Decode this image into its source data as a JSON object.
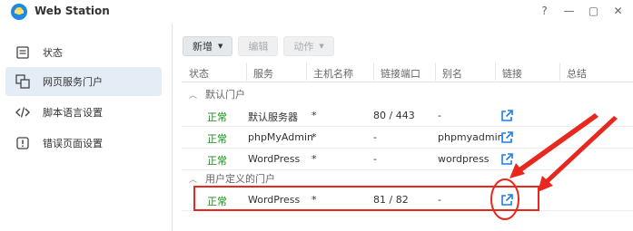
{
  "window": {
    "title": "Web Station",
    "controls": [
      "?",
      "—",
      "▢",
      "✕"
    ]
  },
  "sidebar": {
    "items": [
      {
        "label": "状态",
        "icon": "list-icon"
      },
      {
        "label": "网页服务门户",
        "icon": "portal-icon",
        "active": true
      },
      {
        "label": "脚本语言设置",
        "icon": "code-icon"
      },
      {
        "label": "错误页面设置",
        "icon": "error-icon"
      }
    ]
  },
  "toolbar": {
    "add_label": "新增",
    "edit_label": "编辑",
    "action_label": "动作"
  },
  "table": {
    "headers": [
      "状态",
      "服务",
      "主机名称",
      "链接端口",
      "别名",
      "链接",
      "总结"
    ],
    "groups": [
      {
        "label": "默认门户",
        "rows": [
          {
            "status": "正常",
            "service": "默认服务器",
            "host": "*",
            "port": "80 / 443",
            "alias": "-"
          },
          {
            "status": "正常",
            "service": "phpMyAdmin",
            "host": "*",
            "port": "-",
            "alias": "phpmyadmin"
          },
          {
            "status": "正常",
            "service": "WordPress",
            "host": "*",
            "port": "-",
            "alias": "wordpress"
          }
        ]
      },
      {
        "label": "用户定义的门户",
        "rows": [
          {
            "status": "正常",
            "service": "WordPress",
            "host": "*",
            "port": "81 / 82",
            "alias": "-"
          }
        ]
      }
    ]
  },
  "annotation": {
    "color": "#e8271e"
  }
}
